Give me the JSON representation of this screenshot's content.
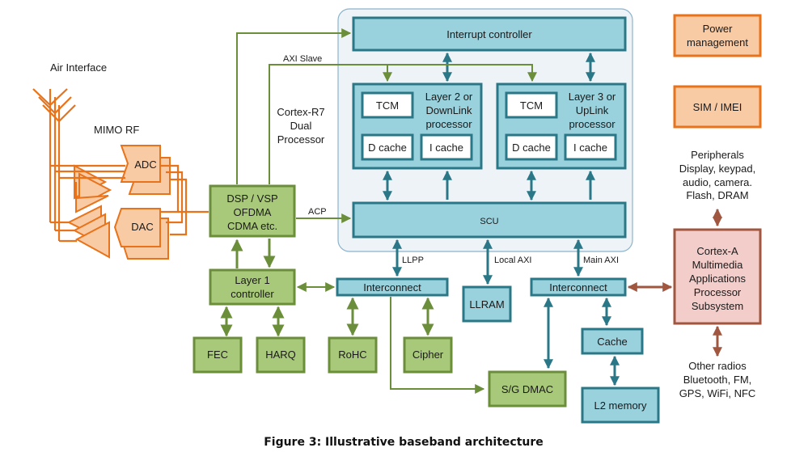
{
  "caption": "Figure 3: Illustrative baseband architecture",
  "rf": {
    "air_interface": "Air Interface",
    "mimo_rf": "MIMO RF",
    "adc": "ADC",
    "dac": "DAC"
  },
  "cortex_r7": {
    "label_lines": [
      "Cortex-R7",
      "Dual",
      "Processor"
    ],
    "interrupt_controller": "Interrupt controller",
    "layer2": {
      "tcm": "TCM",
      "title_lines": [
        "Layer 2 or",
        "DownLink",
        "processor"
      ],
      "dcache": "D cache",
      "icache": "I cache"
    },
    "layer3": {
      "tcm": "TCM",
      "title_lines": [
        "Layer 3 or",
        "UpLink",
        "processor"
      ],
      "dcache": "D cache",
      "icache": "I cache"
    },
    "scu": "SCU"
  },
  "bus_labels": {
    "axi_slave": "AXI Slave",
    "acp": "ACP",
    "llpp": "LLPP",
    "local_axi": "Local AXI",
    "main_axi": "Main AXI"
  },
  "dsp": {
    "lines": [
      "DSP / VSP",
      "OFDMA",
      "CDMA etc."
    ]
  },
  "layer1": {
    "lines": [
      "Layer 1",
      "controller"
    ]
  },
  "blocks": {
    "fec": "FEC",
    "harq": "HARQ",
    "rohc": "RoHC",
    "cipher": "Cipher",
    "interconnect_left": "Interconnect",
    "interconnect_right": "Interconnect",
    "llram": "LLRAM",
    "sg_dmac": "S/G DMAC",
    "cache": "Cache",
    "l2_memory": "L2 memory"
  },
  "right_column": {
    "power_management": [
      "Power",
      "management"
    ],
    "sim_imei": "SIM / IMEI",
    "peripherals": [
      "Peripherals",
      "Display, keypad,",
      "audio, camera.",
      "Flash, DRAM"
    ],
    "cortex_a": [
      "Cortex-A",
      "Multimedia",
      "Applications",
      "Processor",
      "Subsystem"
    ],
    "other_radios": [
      "Other radios",
      "Bluetooth, FM,",
      "GPS, WiFi, NFC"
    ]
  },
  "colors": {
    "teal": "#99d1dd",
    "teal_border": "#2a7887",
    "green": "#a9c97a",
    "green_border": "#6b8e3a",
    "orange": "#f9cba5",
    "orange_border": "#e8731a",
    "pink": "#f2cdca",
    "pink_border": "#a0563f"
  }
}
